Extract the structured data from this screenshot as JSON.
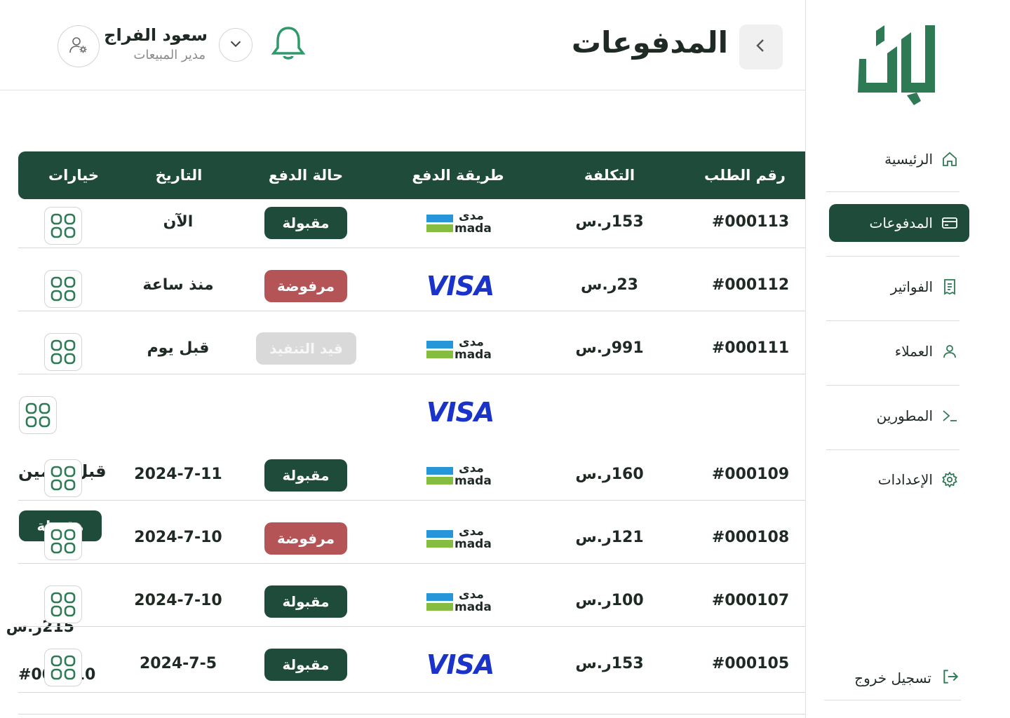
{
  "sidebar": {
    "brand_color": "#2e7a55",
    "items": [
      {
        "label": "الرئيسية",
        "icon": "home-icon",
        "active": false
      },
      {
        "label": "المدفوعات",
        "icon": "card-icon",
        "active": true
      },
      {
        "label": "الفواتير",
        "icon": "invoice-icon",
        "active": false
      },
      {
        "label": "العملاء",
        "icon": "user-icon",
        "active": false
      },
      {
        "label": "المطورين",
        "icon": "terminal-icon",
        "active": false
      },
      {
        "label": "الإعدادات",
        "icon": "gear-icon",
        "active": false
      }
    ],
    "logout_label": "تسجيل خروج"
  },
  "header": {
    "title": "المدفوعات",
    "user_name": "سعود الفراج",
    "user_role": "مدير المبيعات"
  },
  "table": {
    "columns": [
      "رقم الطلب",
      "التكلفة",
      "طريقة الدفع",
      "حالة الدفع",
      "التاريخ",
      "خيارات"
    ],
    "rows": [
      {
        "id": "#000113",
        "cost": "153ر.س",
        "method": "mada",
        "status": "مقبولة",
        "status_type": "accepted",
        "date": "الآن"
      },
      {
        "id": "#000112",
        "cost": "23ر.س",
        "method": "visa",
        "status": "مرفوضة",
        "status_type": "rejected",
        "date": "منذ ساعة"
      },
      {
        "id": "#000111",
        "cost": "991ر.س",
        "method": "mada",
        "status": "قيد التنفيذ",
        "status_type": "pending",
        "date": "قبل يوم"
      },
      {
        "id": "",
        "cost": "",
        "method": "visa",
        "status": "",
        "status_type": "",
        "date": ""
      },
      {
        "id": "#000109",
        "cost": "160ر.س",
        "method": "mada",
        "status": "مقبولة",
        "status_type": "accepted",
        "date": "2024-7-11"
      },
      {
        "id": "#000108",
        "cost": "121ر.س",
        "method": "mada",
        "status": "مرفوضة",
        "status_type": "rejected",
        "date": "2024-7-10"
      },
      {
        "id": "#000107",
        "cost": "100ر.س",
        "method": "mada",
        "status": "مقبولة",
        "status_type": "accepted",
        "date": "2024-7-10"
      },
      {
        "id": "#000105",
        "cost": "153ر.س",
        "method": "visa",
        "status": "مقبولة",
        "status_type": "accepted",
        "date": "2024-7-5"
      }
    ],
    "stray": {
      "date_text": "قبل يومين",
      "badge_text": "مقبولة",
      "cost_text": "215ر.س",
      "id_text": "#000110"
    }
  },
  "payment_labels": {
    "mada_ar": "مدى",
    "mada_en": "mada",
    "visa": "VISA"
  }
}
